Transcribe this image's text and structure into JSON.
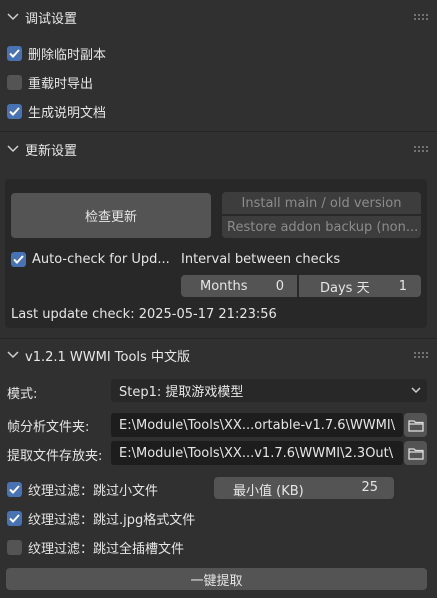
{
  "debug_panel": {
    "title": "调试设置",
    "options": [
      {
        "label": "删除临时副本",
        "checked": true
      },
      {
        "label": "重载时导出",
        "checked": false
      },
      {
        "label": "生成说明文档",
        "checked": true
      }
    ]
  },
  "update_panel": {
    "title": "更新设置",
    "check_button": "检查更新",
    "install_button": "Install main / old version",
    "restore_button": "Restore addon backup (non...",
    "auto_check": {
      "label": "Auto-check for Upd...",
      "checked": true
    },
    "interval_label": "Interval between checks",
    "months": {
      "label": "Months",
      "value": "0"
    },
    "days": {
      "label": "Days 天",
      "value": "1"
    },
    "last_check": "Last update check: 2025-05-17 21:23:56"
  },
  "tools_panel": {
    "title": "v1.2.1 WWMI Tools 中文版",
    "mode_label": "模式:",
    "mode_value": "Step1: 提取游戏模型",
    "frame_dir_label": "帧分析文件夹:",
    "frame_dir_value": "E:\\Module\\Tools\\XX...ortable-v1.7.6\\WWMI\\",
    "out_dir_label": "提取文件存放夹:",
    "out_dir_value": "E:\\Module\\Tools\\XX...v1.7.6\\WWMI\\2.3Out\\",
    "filter_small": {
      "label": "纹理过滤：跳过小文件",
      "checked": true
    },
    "min_size": {
      "label": "最小值 (KB)",
      "value": "25"
    },
    "filter_jpg": {
      "label": "纹理过滤：跳过.jpg格式文件",
      "checked": true
    },
    "filter_slots": {
      "label": "纹理过滤：跳过全插槽文件",
      "checked": false
    },
    "extract_button": "一键提取"
  },
  "colors": {
    "accent": "#4772b3",
    "panel_bg": "#303030",
    "sub_bg": "#282828",
    "button": "#545454",
    "field": "#1d1d1d"
  }
}
